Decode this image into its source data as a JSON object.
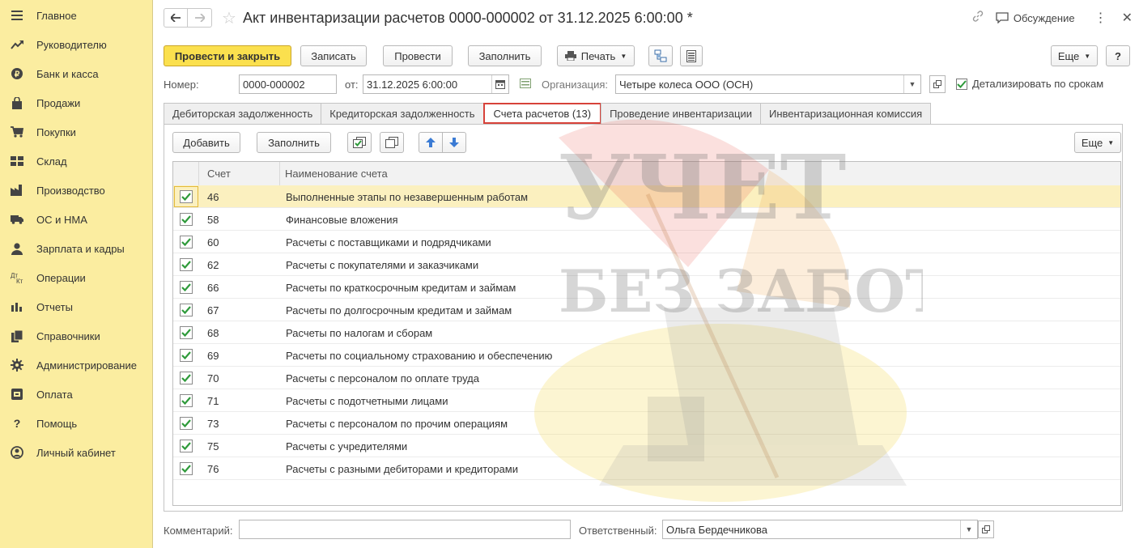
{
  "sidebar": {
    "items": [
      {
        "label": "Главное",
        "icon": "menu-icon"
      },
      {
        "label": "Руководителю",
        "icon": "trend-icon"
      },
      {
        "label": "Банк и касса",
        "icon": "coin-icon"
      },
      {
        "label": "Продажи",
        "icon": "bag-icon"
      },
      {
        "label": "Покупки",
        "icon": "cart-icon"
      },
      {
        "label": "Склад",
        "icon": "warehouse-icon"
      },
      {
        "label": "Производство",
        "icon": "factory-icon"
      },
      {
        "label": "ОС и НМА",
        "icon": "truck-icon"
      },
      {
        "label": "Зарплата и кадры",
        "icon": "person-icon"
      },
      {
        "label": "Операции",
        "icon": "dt-kt-icon"
      },
      {
        "label": "Отчеты",
        "icon": "bar-chart-icon"
      },
      {
        "label": "Справочники",
        "icon": "books-icon"
      },
      {
        "label": "Администрирование",
        "icon": "gear-icon"
      },
      {
        "label": "Оплата",
        "icon": "payment-icon"
      },
      {
        "label": "Помощь",
        "icon": "question-icon"
      },
      {
        "label": "Личный кабинет",
        "icon": "account-icon"
      }
    ]
  },
  "header": {
    "title": "Акт инвентаризации расчетов 0000-000002 от 31.12.2025 6:00:00 *",
    "discussion": "Обсуждение"
  },
  "toolbar": {
    "post_close": "Провести и закрыть",
    "save": "Записать",
    "post": "Провести",
    "fill": "Заполнить",
    "print": "Печать",
    "more": "Еще",
    "help": "?"
  },
  "fields": {
    "number_label": "Номер:",
    "number_value": "0000-000002",
    "date_label": "от:",
    "date_value": "31.12.2025  6:00:00",
    "org_label": "Организация:",
    "org_value": "Четыре колеса ООО (ОСН)",
    "detail_label": "Детализировать по срокам",
    "detail_checked": true
  },
  "tabs": [
    {
      "label": "Дебиторская задолженность",
      "active": false
    },
    {
      "label": "Кредиторская задолженность",
      "active": false
    },
    {
      "label": "Счета расчетов (13)",
      "active": true
    },
    {
      "label": "Проведение инвентаризации",
      "active": false
    },
    {
      "label": "Инвентаризационная комиссия",
      "active": false
    }
  ],
  "table_toolbar": {
    "add": "Добавить",
    "fill": "Заполнить",
    "more": "Еще"
  },
  "table": {
    "columns": [
      "Счет",
      "Наименование счета"
    ],
    "rows": [
      {
        "account": "46",
        "name": "Выполненные этапы по незавершенным работам",
        "checked": true
      },
      {
        "account": "58",
        "name": "Финансовые вложения",
        "checked": true
      },
      {
        "account": "60",
        "name": "Расчеты с поставщиками и подрядчиками",
        "checked": true
      },
      {
        "account": "62",
        "name": "Расчеты с покупателями и заказчиками",
        "checked": true
      },
      {
        "account": "66",
        "name": "Расчеты по краткосрочным кредитам и займам",
        "checked": true
      },
      {
        "account": "67",
        "name": "Расчеты по долгосрочным кредитам и займам",
        "checked": true
      },
      {
        "account": "68",
        "name": "Расчеты по налогам и сборам",
        "checked": true
      },
      {
        "account": "69",
        "name": "Расчеты по социальному страхованию и обеспечению",
        "checked": true
      },
      {
        "account": "70",
        "name": "Расчеты с персоналом по оплате труда",
        "checked": true
      },
      {
        "account": "71",
        "name": "Расчеты с подотчетными лицами",
        "checked": true
      },
      {
        "account": "73",
        "name": "Расчеты с персоналом по прочим операциям",
        "checked": true
      },
      {
        "account": "75",
        "name": "Расчеты с учредителями",
        "checked": true
      },
      {
        "account": "76",
        "name": "Расчеты с разными дебиторами и кредиторами",
        "checked": true
      }
    ]
  },
  "footer": {
    "comment_label": "Комментарий:",
    "comment_value": "",
    "responsible_label": "Ответственный:",
    "responsible_value": "Ольга Бердечникова"
  },
  "watermark": {
    "line1": "УЧЕТ",
    "line2": "БЕЗ ЗАБОТ"
  },
  "colors": {
    "sidebar_bg": "#fbeda0",
    "primary_button": "#fbe04e",
    "active_tab_border": "#d7423a",
    "selected_row": "#fbf0bf",
    "check_green": "#2e9a3a"
  }
}
